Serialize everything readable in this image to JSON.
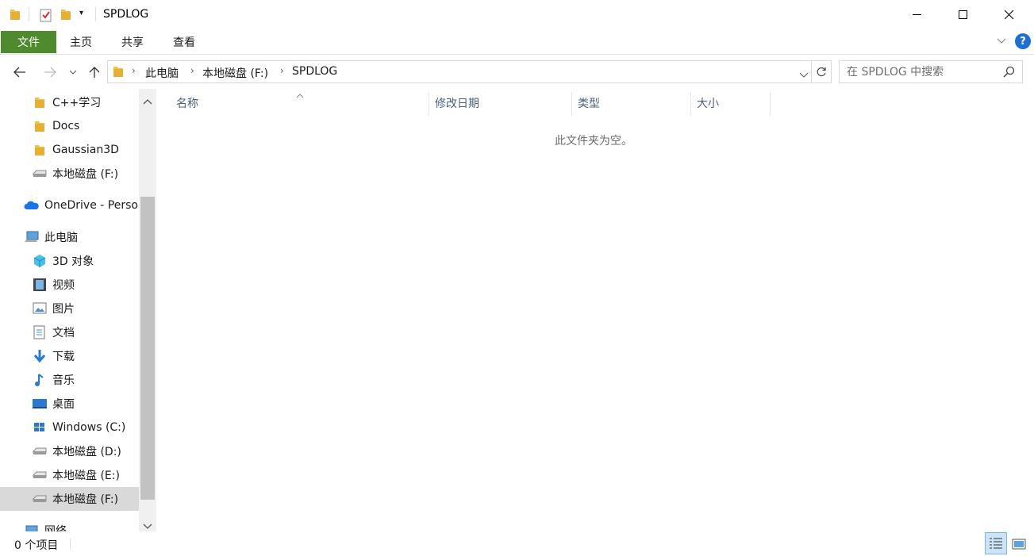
{
  "window": {
    "title": "SPDLOG"
  },
  "ribbon": {
    "file": "文件",
    "home": "主页",
    "share": "共享",
    "view": "查看"
  },
  "address": {
    "crumbs": [
      "此电脑",
      "本地磁盘 (F:)",
      "SPDLOG"
    ]
  },
  "search": {
    "placeholder": "在 SPDLOG 中搜索"
  },
  "nav": {
    "items": [
      {
        "label": "C++学习",
        "icon": "folder-icon"
      },
      {
        "label": "Docs",
        "icon": "folder-icon"
      },
      {
        "label": "Gaussian3D",
        "icon": "folder-icon"
      },
      {
        "label": "本地磁盘 (F:)",
        "icon": "drive-icon"
      },
      {
        "label": "OneDrive - Personal",
        "icon": "onedrive-icon"
      },
      {
        "label": "此电脑",
        "icon": "computer-icon"
      },
      {
        "label": "3D 对象",
        "icon": "3d-objects-icon"
      },
      {
        "label": "视频",
        "icon": "video-icon"
      },
      {
        "label": "图片",
        "icon": "pictures-icon"
      },
      {
        "label": "文档",
        "icon": "documents-icon"
      },
      {
        "label": "下载",
        "icon": "download-icon"
      },
      {
        "label": "音乐",
        "icon": "music-icon"
      },
      {
        "label": "桌面",
        "icon": "desktop-icon"
      },
      {
        "label": "Windows (C:)",
        "icon": "windows-drive-icon"
      },
      {
        "label": "本地磁盘 (D:)",
        "icon": "drive-icon"
      },
      {
        "label": "本地磁盘 (E:)",
        "icon": "drive-icon"
      },
      {
        "label": "本地磁盘 (F:)",
        "icon": "drive-icon"
      },
      {
        "label": "网络",
        "icon": "network-icon"
      }
    ]
  },
  "columns": {
    "name": "名称",
    "modified": "修改日期",
    "type": "类型",
    "size": "大小"
  },
  "content": {
    "empty_message": "此文件夹为空。"
  },
  "status": {
    "count": "0 个项目"
  },
  "colors": {
    "file_tab": "#4f8a2e",
    "selected": "#d9d9d9",
    "help": "#1f6fd1"
  }
}
